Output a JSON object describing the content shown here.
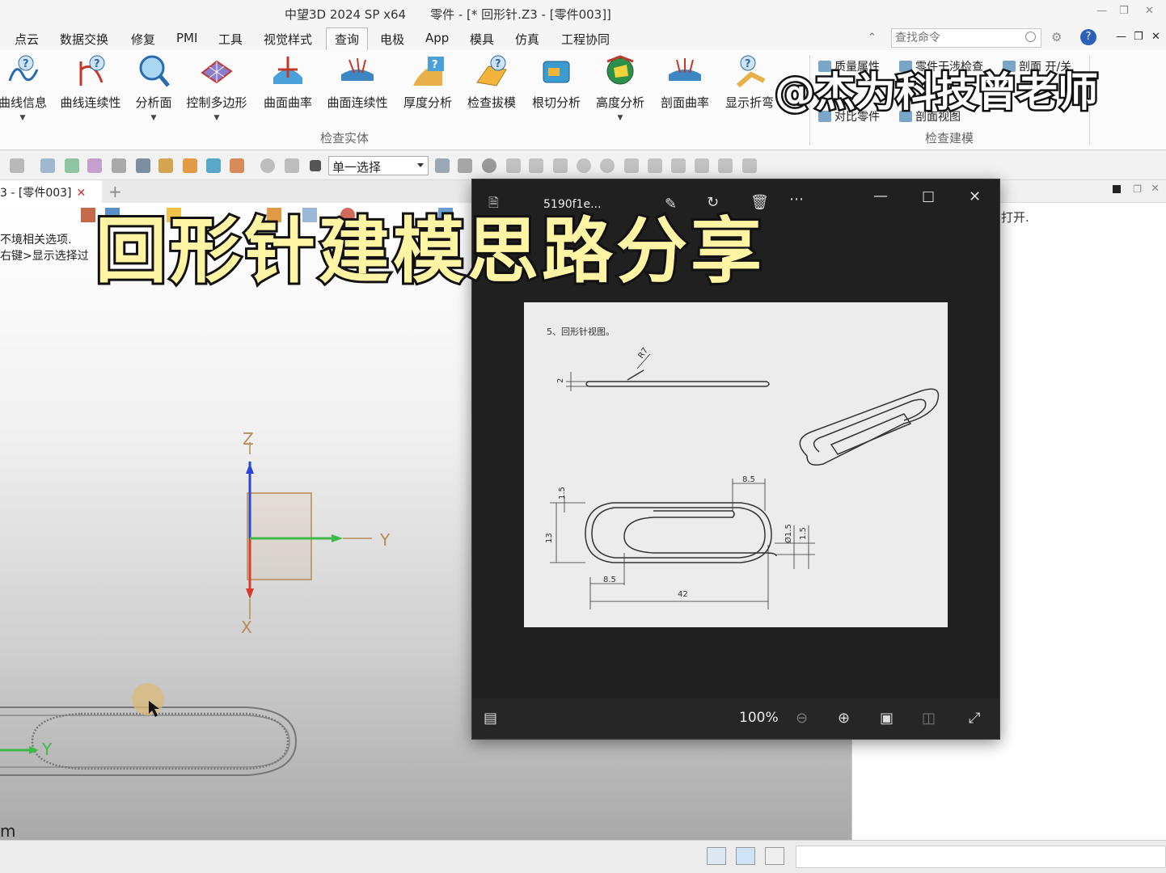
{
  "titlebar": {
    "app_title": "中望3D 2024 SP x64",
    "doc_title": "零件 - [* 回形针.Z3 - [零件003]]"
  },
  "menubar": {
    "items": [
      "点云",
      "数据交换",
      "修复",
      "PMI",
      "工具",
      "视觉样式",
      "查询",
      "电极",
      "App",
      "模具",
      "仿真",
      "工程协同"
    ],
    "active": "查询",
    "search_placeholder": "查找命令"
  },
  "ribbon": {
    "tools": [
      "曲线信息",
      "曲线连续性",
      "分析面",
      "控制多边形",
      "曲面曲率",
      "曲面连续性",
      "厚度分析",
      "检查拔模",
      "根切分析",
      "高度分析",
      "剖面曲率",
      "显示折弯"
    ],
    "group_inspect_entity": "检查实体",
    "small_tools": [
      "质量属性",
      "零件干涉检查",
      "剖面 开/关",
      "对比零件",
      "剖面视图"
    ],
    "group_inspect_model": "检查建模"
  },
  "toolbar": {
    "select_mode": "单一选择"
  },
  "doc_tab": {
    "label": "3 - [零件003]"
  },
  "viewport": {
    "tip_line1": "不境相关选项.",
    "tip_line2": "右键>显示选择过",
    "axis_z": "Z",
    "axis_y": "Y",
    "axis_x": "X",
    "mini_axis_y": "Y",
    "unit": "m"
  },
  "right_panel": {
    "message": "打开."
  },
  "viewer": {
    "file_name": "5190f1e...",
    "zoom": "100%",
    "drawing": {
      "caption": "5、回形针视图。",
      "dims": [
        "R7",
        "2",
        "8.5",
        "1.5",
        "13",
        "Ø1.5",
        "1.5",
        "8.5",
        "42"
      ]
    }
  },
  "overlay": {
    "title": "回形针建模思路分享",
    "watermark": "@杰为科技曾老师"
  },
  "colors": {
    "axis_z": "#2a43d8",
    "axis_y": "#3fb94a",
    "axis_x": "#d93a2a",
    "overlay_fill": "#fff3a4",
    "viewer_bg": "#202020"
  }
}
